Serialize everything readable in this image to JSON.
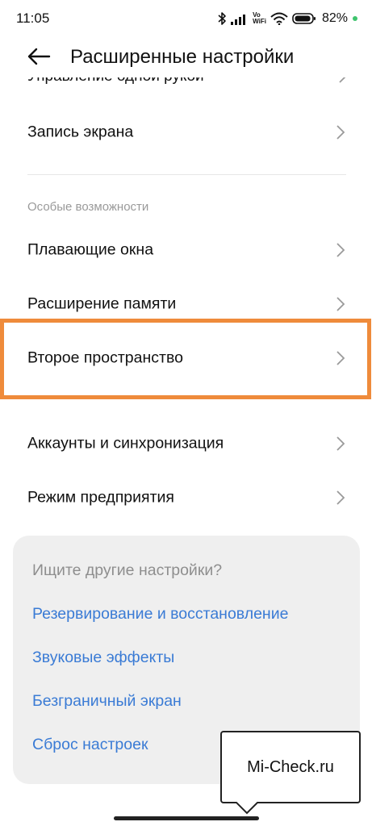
{
  "status_bar": {
    "time": "11:05",
    "volte_top": "Vo",
    "volte_bottom": "WiFi",
    "battery_percent": "82%",
    "icons": [
      "bluetooth-icon",
      "signal-icon",
      "volte-wifi-icon",
      "wifi-icon",
      "battery-icon",
      "green-dot-indicator"
    ]
  },
  "header": {
    "back_icon": "arrow-left-icon",
    "title": "Расширенные настройки"
  },
  "list": {
    "cut_off_item": "Управление одной рукой",
    "screen_record": "Запись экрана",
    "section_title": "Особые возможности",
    "floating_windows": "Плавающие окна",
    "memory_extension": "Расширение памяти",
    "second_space": "Второе пространство",
    "accounts_sync": "Аккаунты и синхронизация",
    "enterprise_mode": "Режим предприятия"
  },
  "card": {
    "title": "Ищите другие настройки?",
    "links": [
      "Резервирование и восстановление",
      "Звуковые эффекты",
      "Безграничный экран",
      "Сброс настроек"
    ]
  },
  "watermark": {
    "text": "Mi-Check.ru"
  },
  "colors": {
    "highlight": "#ef8b3b",
    "link": "#3a7bd5",
    "card_bg": "#efefef",
    "status_dot": "#3ec46d"
  }
}
